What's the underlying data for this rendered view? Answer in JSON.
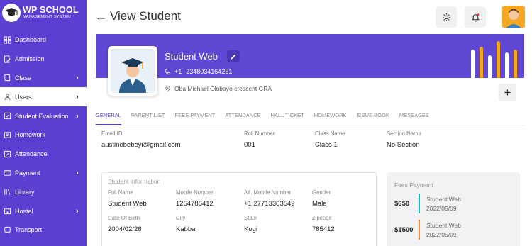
{
  "brand": {
    "title": "WP SCHOOL",
    "subtitle": "MANAGEMENT SYSTEM"
  },
  "sidebar": {
    "items": [
      {
        "label": "Dashboard",
        "icon": "grid-icon",
        "chevron": false,
        "active": false
      },
      {
        "label": "Admission",
        "icon": "edit-doc-icon",
        "chevron": false,
        "active": false
      },
      {
        "label": "Class",
        "icon": "book-icon",
        "chevron": true,
        "active": false
      },
      {
        "label": "Users",
        "icon": "user-icon",
        "chevron": true,
        "active": true
      },
      {
        "label": "Student Evaluation",
        "icon": "evaluation-icon",
        "chevron": true,
        "active": false
      },
      {
        "label": "Homework",
        "icon": "homework-icon",
        "chevron": false,
        "active": false
      },
      {
        "label": "Attendance",
        "icon": "checkbox-icon",
        "chevron": false,
        "active": false
      },
      {
        "label": "Payment",
        "icon": "wallet-icon",
        "chevron": true,
        "active": false
      },
      {
        "label": "Library",
        "icon": "library-icon",
        "chevron": false,
        "active": false
      },
      {
        "label": "Hostel",
        "icon": "hostel-icon",
        "chevron": true,
        "active": false
      },
      {
        "label": "Transport",
        "icon": "bus-icon",
        "chevron": false,
        "active": false
      }
    ]
  },
  "header": {
    "back_arrow": "←",
    "title": "View Student",
    "settings_icon": "gear-icon",
    "notification_icon": "bell-icon"
  },
  "profile": {
    "name": "Student Web",
    "phone_code": "+1",
    "phone": "2348034164251",
    "address": "Oba Michael Olobayo crescent GRA",
    "add_label": "+",
    "bar_colors": [
      "#ffffff",
      "#f5a623"
    ]
  },
  "tabs": [
    "GENERAL",
    "PARENT LIST",
    "FEES PAYMENT",
    "ATTENDANCE",
    "HALL TICKET",
    "HOMEWORK",
    "ISSUE BOOK",
    "MESSAGES"
  ],
  "summary": {
    "email_label": "Email ID",
    "email": "austinebebeyi@gmail.com",
    "roll_label": "Roll Number",
    "roll": "001",
    "class_label": "Class Name",
    "class": "Class 1",
    "section_label": "Section Name",
    "section": "No Section"
  },
  "student_info": {
    "title": "Student Information",
    "fullname_label": "Full Name",
    "fullname": "Student Web",
    "mobile_label": "Mobile Number",
    "mobile": "1254785412",
    "alt_mobile_label": "Alt. Mobile Number",
    "alt_mobile": "+1 27713303549",
    "gender_label": "Gender",
    "gender": "Male",
    "dob_label": "Date Of Birth",
    "dob": "2004/02/26",
    "city_label": "City",
    "city": "Kabba",
    "state_label": "State",
    "state": "Kogi",
    "zip_label": "Zipcode",
    "zip": "785412"
  },
  "fees": {
    "title": "Fees Payment",
    "rows": [
      {
        "amount": "$650",
        "name": "Student Web",
        "date": "2022/05/09",
        "color": "#1fb8c4"
      },
      {
        "amount": "$1500",
        "name": "Student Web",
        "date": "2022/05/09",
        "color": "#f08a3c"
      }
    ]
  },
  "colors": {
    "sidebar": "#5b3fd0",
    "banner": "#6148d4",
    "accent": "#5b3fd0",
    "orange": "#f5a623"
  }
}
